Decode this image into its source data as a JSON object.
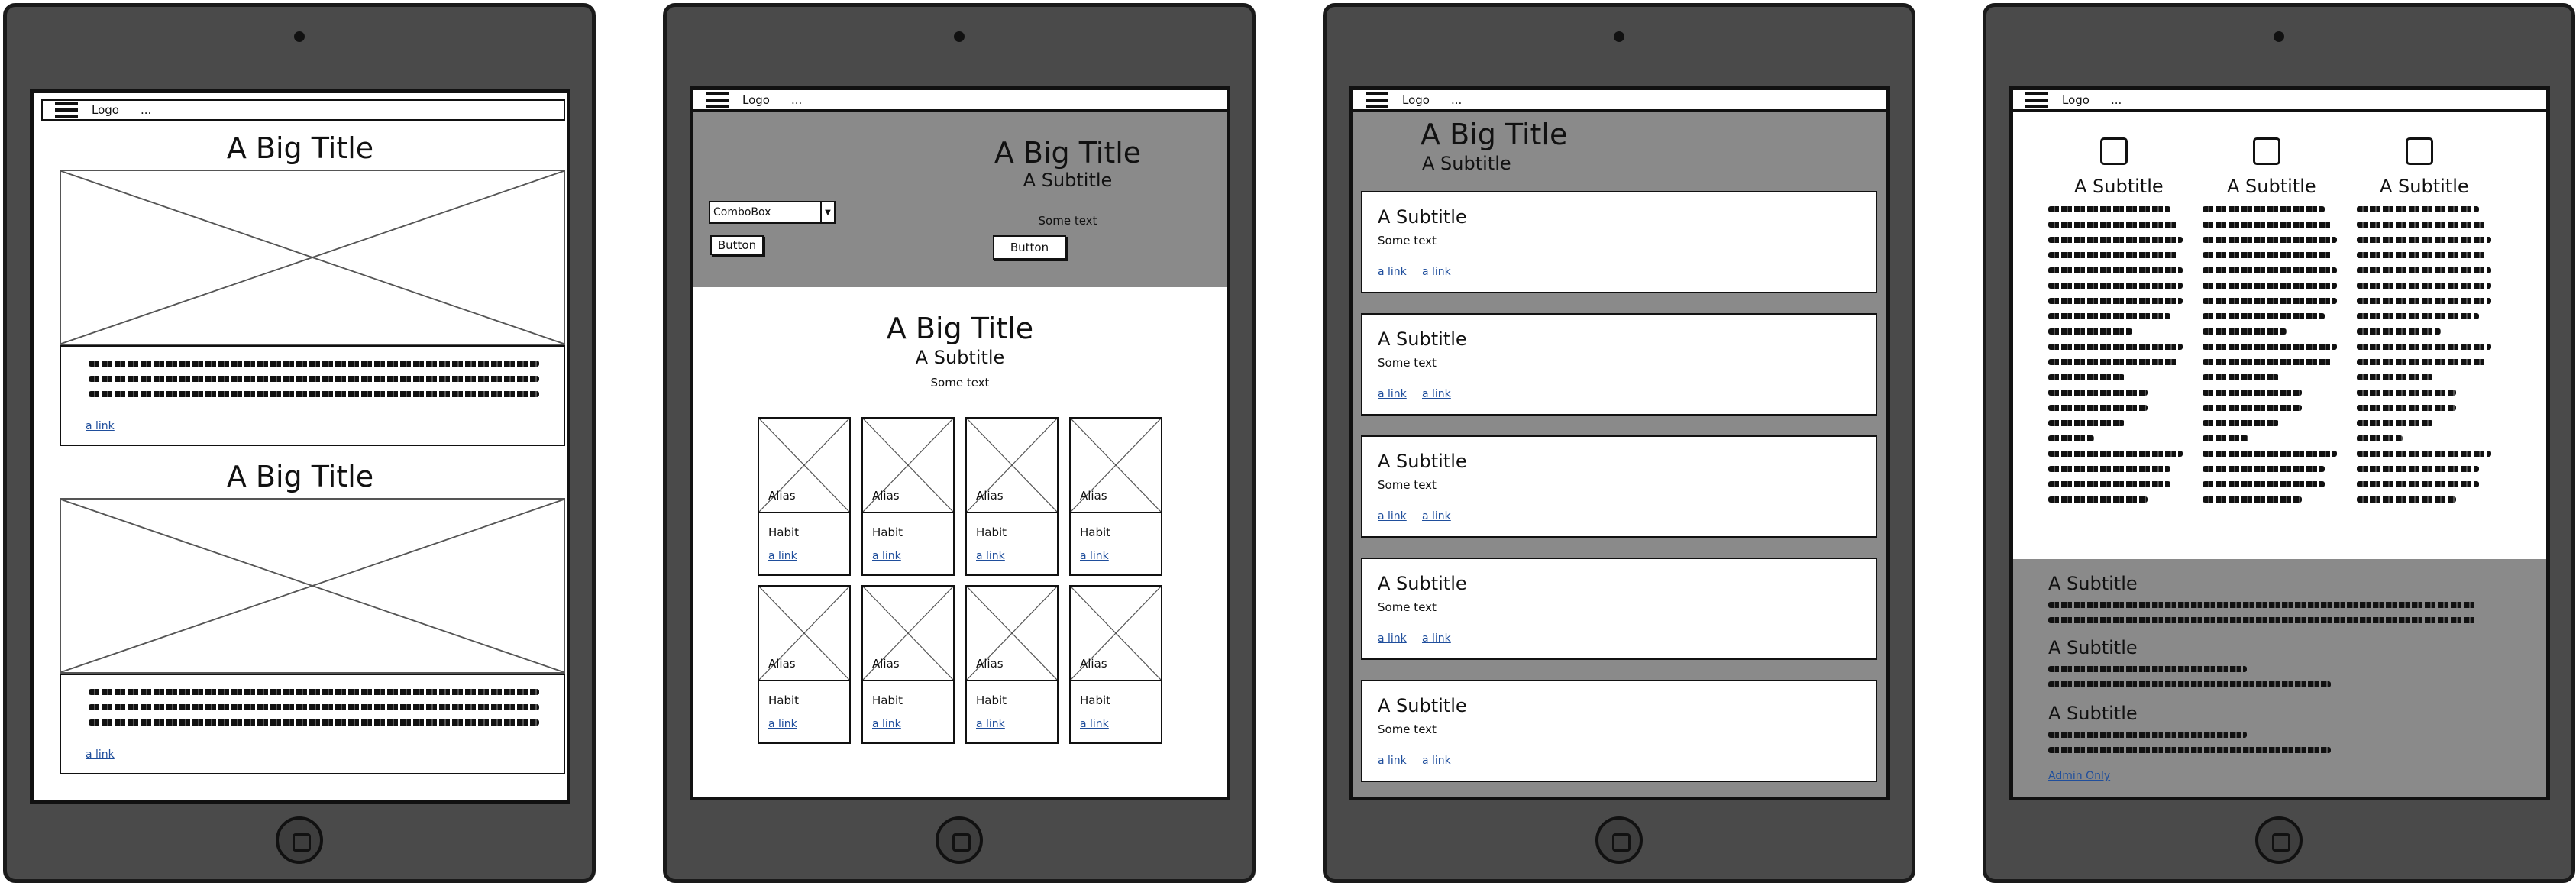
{
  "common": {
    "logo": "Logo",
    "nav_extra": "...",
    "big_title": "A Big Title",
    "subtitle": "A Subtitle",
    "some_text": "Some text",
    "link": "a link"
  },
  "device2": {
    "combobox_value": "ComboBox",
    "button_left": "Button",
    "button_right": "Button",
    "grid_alias": "Alias",
    "grid_habit": "Habit"
  },
  "device4": {
    "admin_link": "Admin Only"
  },
  "colors": {
    "device_body": "#4a4a4a",
    "gray_band": "#8a8a8a",
    "link": "#1f4e9c"
  },
  "icons": [
    "hamburger-icon",
    "image-placeholder-icon",
    "checkbox-icon",
    "home-button-icon",
    "camera-icon"
  ]
}
